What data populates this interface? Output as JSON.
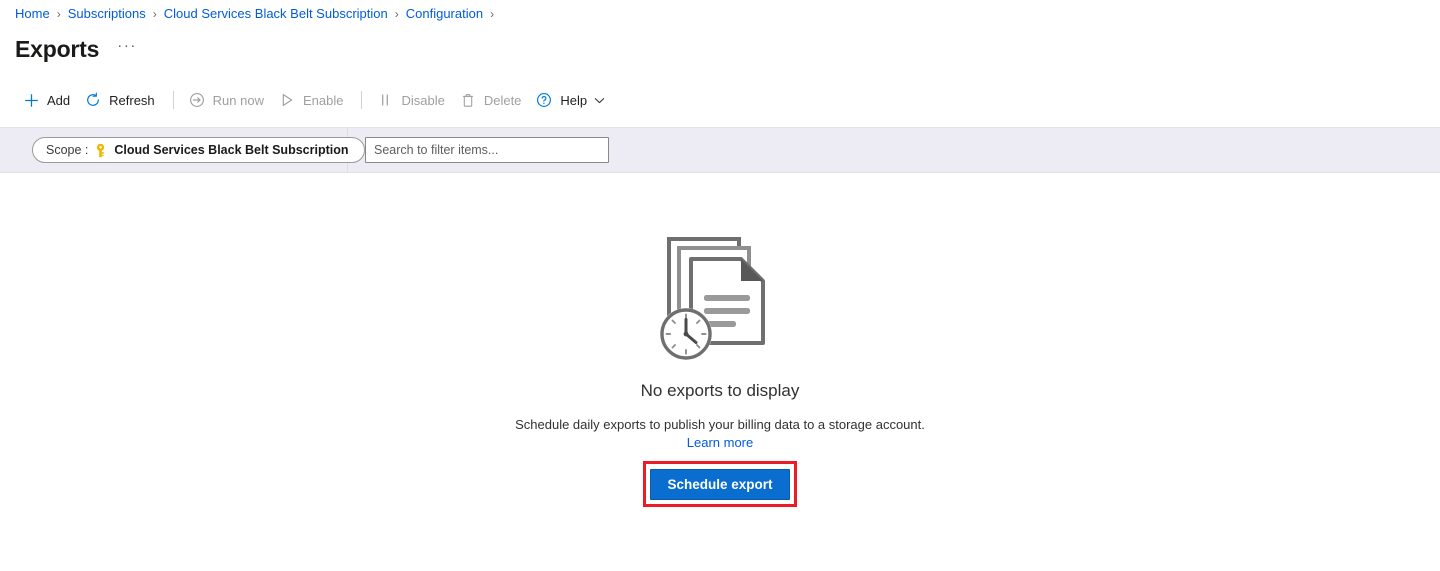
{
  "breadcrumb": {
    "separator": "›",
    "items": [
      {
        "label": "Home"
      },
      {
        "label": "Subscriptions"
      },
      {
        "label": "Cloud Services Black Belt Subscription"
      },
      {
        "label": "Configuration"
      }
    ]
  },
  "header": {
    "title": "Exports",
    "more_options": "···"
  },
  "toolbar": {
    "items": [
      {
        "label": "Add",
        "icon": "plus-icon",
        "enabled": true
      },
      {
        "label": "Refresh",
        "icon": "refresh-icon",
        "enabled": true
      },
      {
        "label": "Run now",
        "icon": "run-now-icon",
        "enabled": false
      },
      {
        "label": "Enable",
        "icon": "play-icon",
        "enabled": false
      },
      {
        "label": "Disable",
        "icon": "pause-icon",
        "enabled": false
      },
      {
        "label": "Delete",
        "icon": "trash-icon",
        "enabled": false
      },
      {
        "label": "Help",
        "icon": "help-circle-icon",
        "enabled": true,
        "has_chevron": true
      }
    ]
  },
  "filters": {
    "scope": {
      "label": "Scope :",
      "icon": "subscription-key-icon",
      "value": "Cloud Services Black Belt Subscription"
    },
    "search": {
      "placeholder": "Search to filter items...",
      "value": ""
    }
  },
  "empty_state": {
    "illustration": "scheduled-documents-clock-illustration",
    "heading": "No exports to display",
    "description": "Schedule daily exports to publish your billing data to a storage account.",
    "learn_more_label": "Learn more",
    "primary_button_label": "Schedule export"
  },
  "colors": {
    "link": "#015cda",
    "primary_button": "#0a6ed1",
    "highlight_box": "#ec1c24",
    "filter_bar_bg": "#edecf4",
    "key_icon": "#f2b600",
    "illustration_gray": "#6d6d6d"
  }
}
